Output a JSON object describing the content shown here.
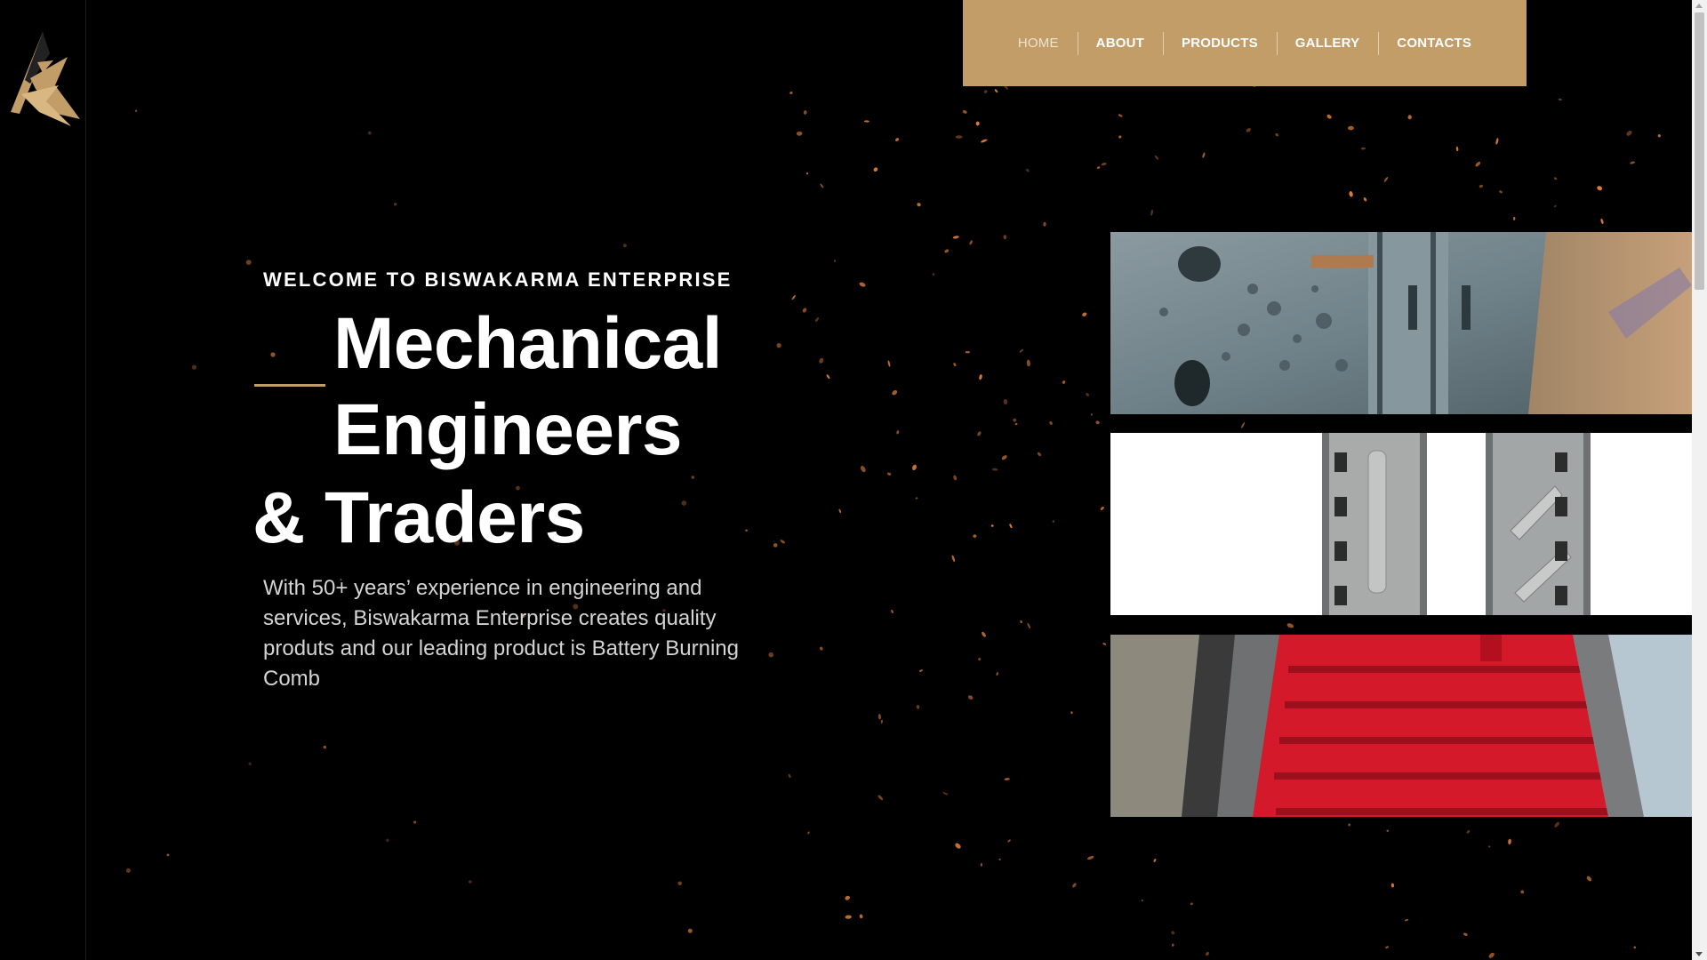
{
  "nav": {
    "items": [
      {
        "label": "HOME",
        "active": true
      },
      {
        "label": "ABOUT",
        "active": false
      },
      {
        "label": "PRODUCTS",
        "active": false
      },
      {
        "label": "GALLERY",
        "active": false
      },
      {
        "label": "CONTACTS",
        "active": false
      }
    ]
  },
  "hero": {
    "kicker": "WELCOME TO BISWAKARMA ENTERPRISE",
    "title_line1": "Mechanical",
    "title_line2": "Engineers",
    "title_line3": "& Traders",
    "description": "With 50+ years’ experience in engineering and services, Biswakarma Enterprise creates quality produts and our leading product is Battery Burning Comb"
  },
  "products": [
    {
      "name": "metal-mold-plate-image"
    },
    {
      "name": "aluminium-comb-molds-image"
    },
    {
      "name": "red-battery-burning-comb-image"
    }
  ],
  "colors": {
    "accent": "#c29d68",
    "background": "#000000",
    "text": "#ffffff",
    "spark": "#e9833a"
  }
}
